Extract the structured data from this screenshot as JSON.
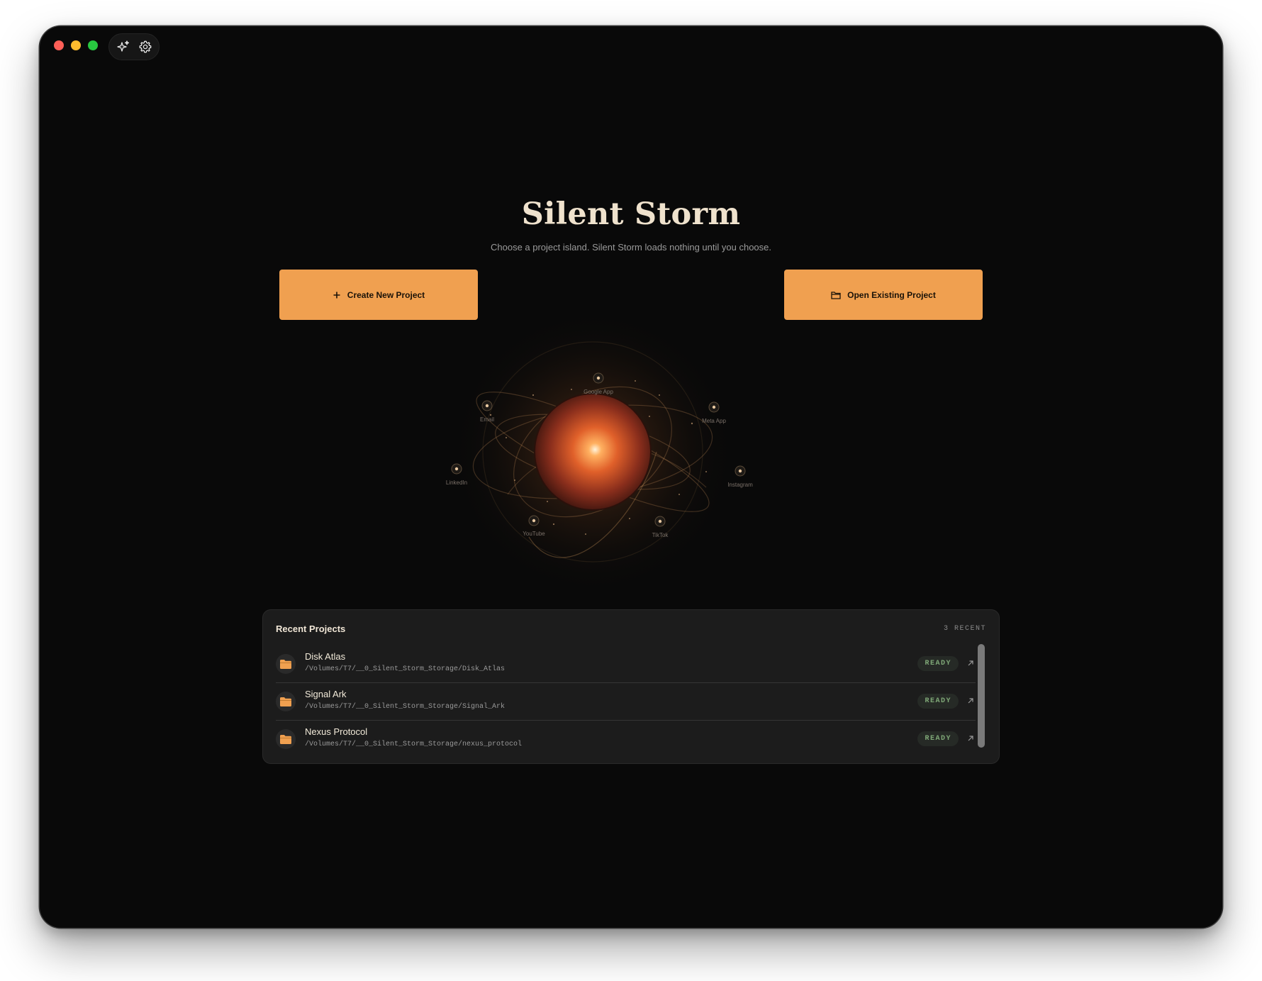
{
  "window": {
    "toolbar": {
      "icons": [
        "sparkles-icon",
        "gear-icon"
      ]
    }
  },
  "hero": {
    "title": "Silent Storm",
    "subtitle": "Choose a project island. Silent Storm loads nothing until you choose."
  },
  "actions": {
    "create_label": "Create New Project",
    "open_label": "Open Existing Project"
  },
  "orbit": {
    "nodes": [
      "Google App",
      "Email",
      "Meta App",
      "LinkedIn",
      "Instagram",
      "YouTube",
      "TikTok"
    ]
  },
  "recent": {
    "title": "Recent Projects",
    "count_label": "3 RECENT",
    "items": [
      {
        "name": "Disk Atlas",
        "path": "/Volumes/T7/__0_Silent_Storm_Storage/Disk_Atlas",
        "status": "READY"
      },
      {
        "name": "Signal Ark",
        "path": "/Volumes/T7/__0_Silent_Storm_Storage/Signal_Ark",
        "status": "READY"
      },
      {
        "name": "Nexus Protocol",
        "path": "/Volumes/T7/__0_Silent_Storm_Storage/nexus_protocol",
        "status": "READY"
      }
    ]
  },
  "colors": {
    "accent": "#f0a050",
    "background": "#090909",
    "ready": "#7fa877"
  }
}
